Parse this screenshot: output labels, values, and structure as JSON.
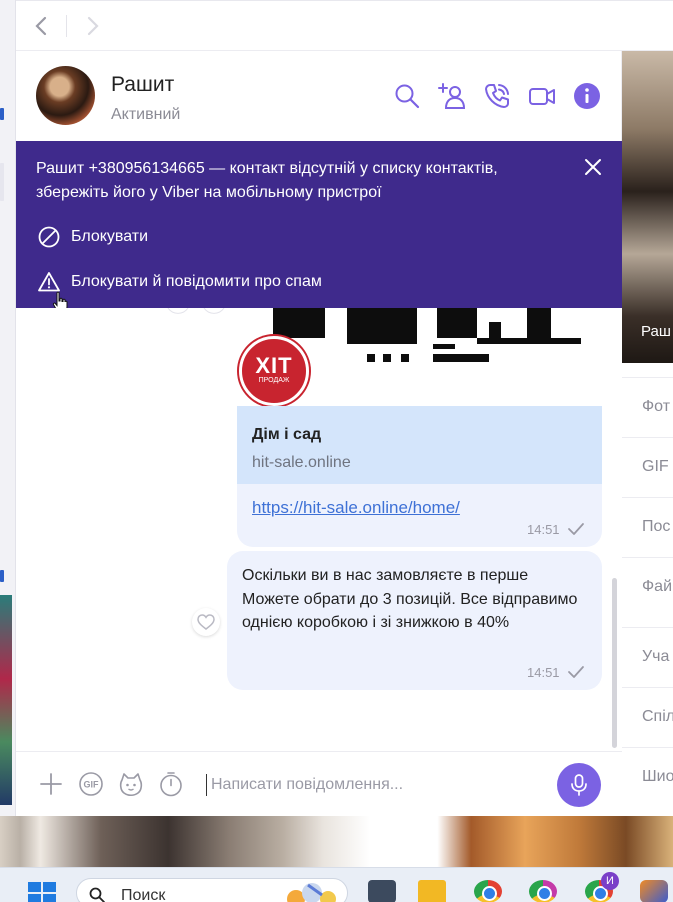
{
  "nav": {
    "back_icon": "chevron-left-icon",
    "forward_icon": "chevron-right-icon"
  },
  "contact": {
    "name": "Рашит",
    "status": "Активний"
  },
  "header_icons": [
    "search-icon",
    "add-contact-icon",
    "call-icon",
    "video-call-icon",
    "info-icon"
  ],
  "banner": {
    "message": "Рашит +380956134665 — контакт відсутній у списку контактів, збережіть його у Viber на мобільному пристрої",
    "block_label": "Блокувати",
    "block_spam_label": "Блокувати й повідомити про спам",
    "background": "#3f2a8c"
  },
  "messages": {
    "link_card": {
      "badge_text": "ХІТ",
      "badge_sub": "ПРОДАЖ",
      "title": "Дім і сад",
      "domain": "hit-sale.online",
      "url": "https://hit-sale.online/home/",
      "time": "14:51"
    },
    "text_message": {
      "text": "Оскільки ви в нас замовляєте в перше Можете обрати до 3 позицій. Все відправимо однією коробкою і зі знижкою в 40%",
      "time": "14:51"
    }
  },
  "composer": {
    "placeholder": "Написати повідомлення...",
    "accent": "#7b62e3"
  },
  "info_panel": {
    "photo_name": "Раш",
    "items": [
      "Фот",
      "GIF",
      "Пос",
      "Фай",
      "Уча",
      "Спіл",
      "Шио"
    ]
  },
  "taskbar": {
    "search_label": "Поиск",
    "badge": "И"
  }
}
